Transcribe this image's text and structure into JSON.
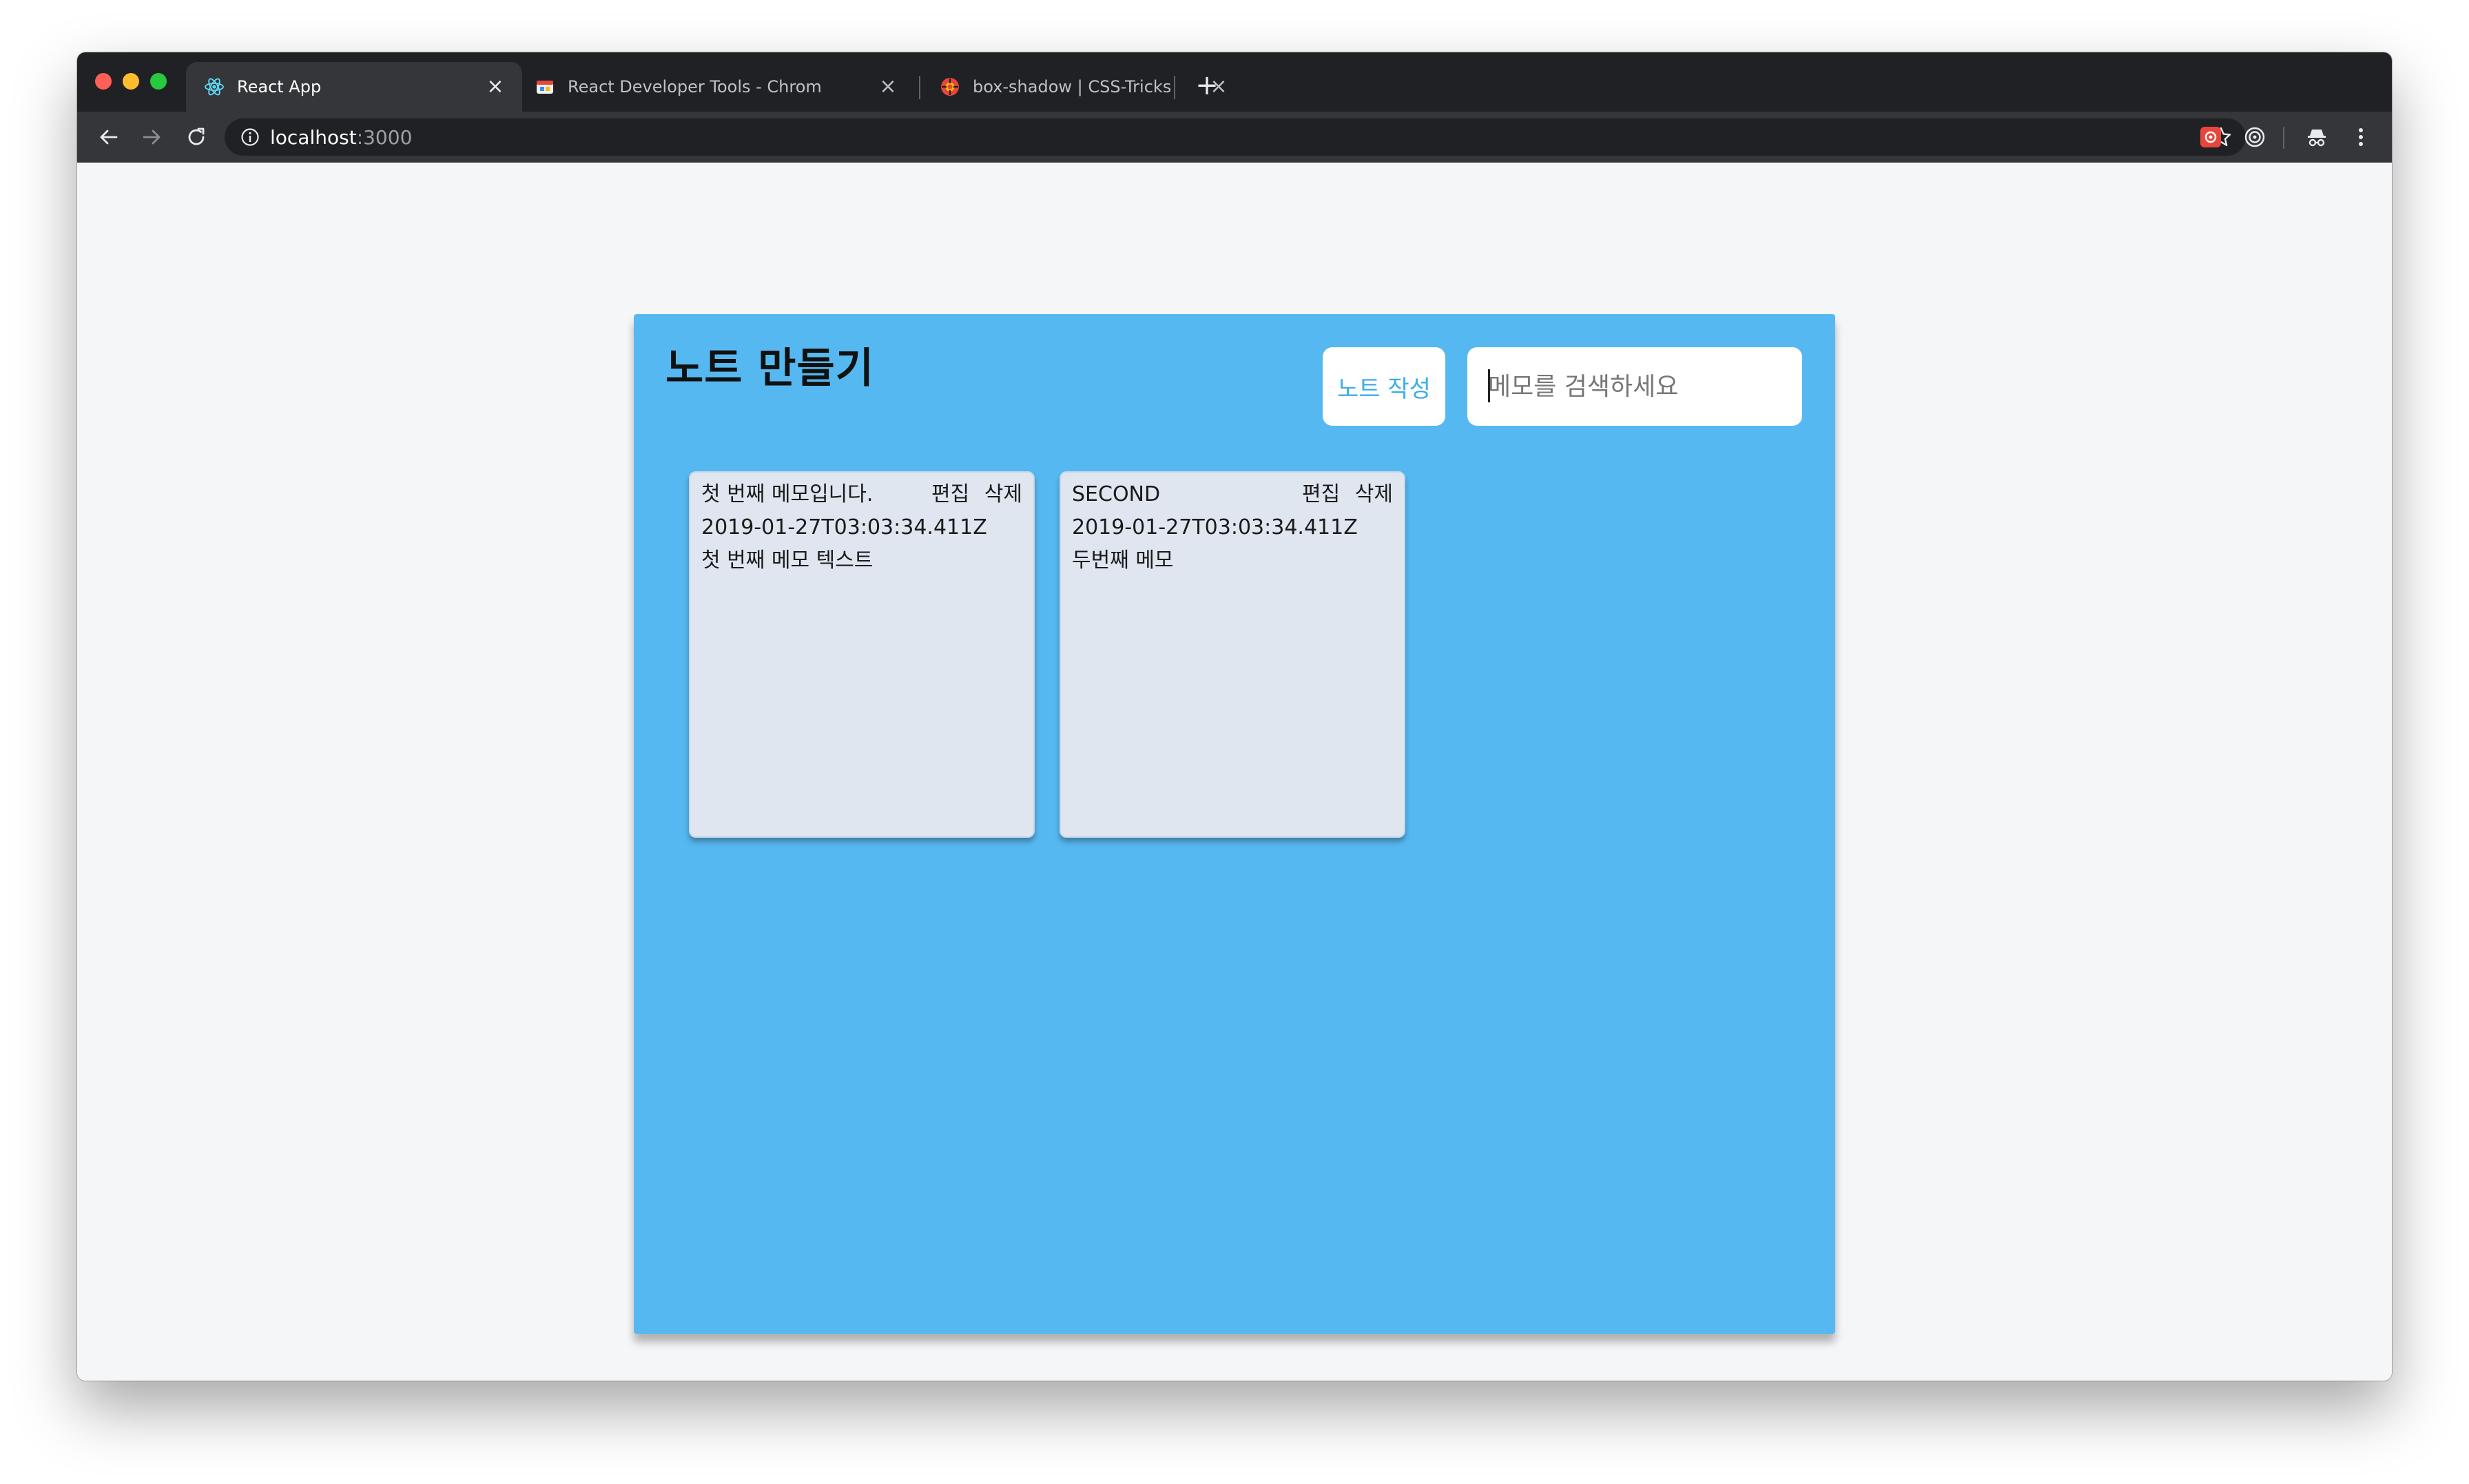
{
  "browser": {
    "tabs": [
      {
        "title": "React App",
        "icon": "react-logo-icon",
        "active": true
      },
      {
        "title": "React Developer Tools - Chrom",
        "icon": "react-devtools-icon",
        "active": false
      },
      {
        "title": "box-shadow | CSS-Tricks",
        "icon": "css-tricks-icon",
        "active": false
      }
    ],
    "new_tab_glyph": "+",
    "close_glyph": "×",
    "address": {
      "host": "localhost",
      "port": ":3000"
    }
  },
  "app": {
    "title": "노트 만들기",
    "create_button_label": "노트 작성",
    "search_placeholder": "메모를 검색하세요",
    "notes": [
      {
        "title": "첫 번째 메모입니다.",
        "date": "2019-01-27T03:03:34.411Z",
        "text": "첫 번째 메모 텍스트",
        "edit_label": "편집",
        "delete_label": "삭제"
      },
      {
        "title": "SECOND",
        "date": "2019-01-27T03:03:34.411Z",
        "text": "두번째 메모",
        "edit_label": "편집",
        "delete_label": "삭제"
      }
    ]
  },
  "colors": {
    "app_background": "#56b8f1",
    "card_background": "#dfe6f0",
    "button_text": "#3aaee8",
    "page_background": "#f5f6f8",
    "tabstrip": "#202124",
    "toolbar": "#35363a"
  }
}
